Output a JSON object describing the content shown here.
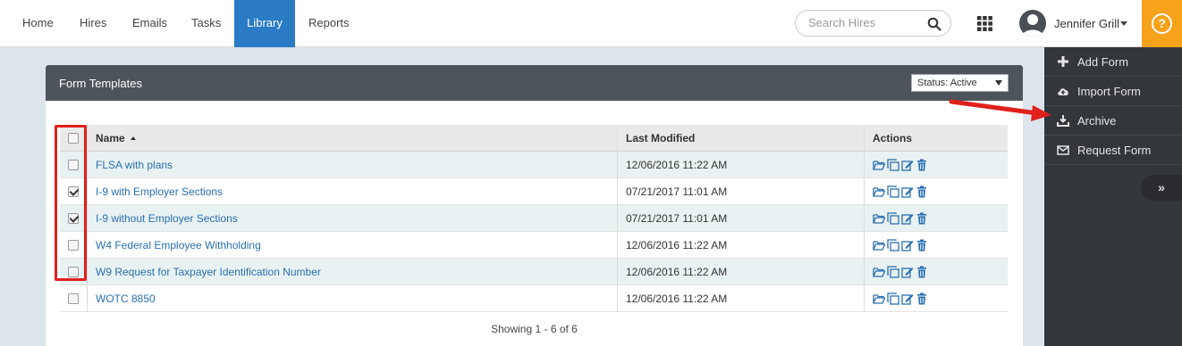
{
  "nav": {
    "items": [
      {
        "label": "Home",
        "active": false
      },
      {
        "label": "Hires",
        "active": false
      },
      {
        "label": "Emails",
        "active": false
      },
      {
        "label": "Tasks",
        "active": false
      },
      {
        "label": "Library",
        "active": true
      },
      {
        "label": "Reports",
        "active": false
      }
    ],
    "search_placeholder": "Search Hires",
    "user_name": "Jennifer Grill"
  },
  "sidebar": {
    "items": [
      {
        "label": "Add Form",
        "icon": "plus-icon"
      },
      {
        "label": "Import Form",
        "icon": "cloud-upload-icon"
      },
      {
        "label": "Archive",
        "icon": "download-icon"
      },
      {
        "label": "Request Form",
        "icon": "envelope-icon"
      }
    ],
    "collapse_label": "»"
  },
  "panel": {
    "title": "Form Templates",
    "status_label": "Status: Active",
    "columns": [
      "Name",
      "Last Modified",
      "Actions"
    ],
    "rows": [
      {
        "name": "FLSA with plans",
        "modified": "12/06/2016 11:22 AM",
        "checked": false
      },
      {
        "name": "I-9 with Employer Sections",
        "modified": "07/21/2017 11:01 AM",
        "checked": true
      },
      {
        "name": "I-9 without Employer Sections",
        "modified": "07/21/2017 11:01 AM",
        "checked": true
      },
      {
        "name": "W4 Federal Employee Withholding",
        "modified": "12/06/2016 11:22 AM",
        "checked": false
      },
      {
        "name": "W9 Request for Taxpayer Identification Number",
        "modified": "12/06/2016 11:22 AM",
        "checked": false
      },
      {
        "name": "WOTC 8850",
        "modified": "12/06/2016 11:22 AM",
        "checked": false
      }
    ],
    "footer": "Showing 1 - 6 of 6"
  },
  "colors": {
    "accent": "#2a7bc4",
    "help": "#f7a21b",
    "annotation": "#e0201b"
  }
}
